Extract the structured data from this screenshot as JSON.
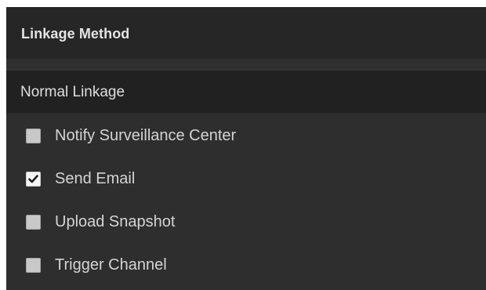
{
  "panel": {
    "title": "Linkage Method"
  },
  "section": {
    "title": "Normal Linkage"
  },
  "options": [
    {
      "label": "Notify Surveillance Center",
      "checked": false
    },
    {
      "label": "Send Email",
      "checked": true
    },
    {
      "label": "Upload Snapshot",
      "checked": false
    },
    {
      "label": "Trigger Channel",
      "checked": false
    }
  ]
}
